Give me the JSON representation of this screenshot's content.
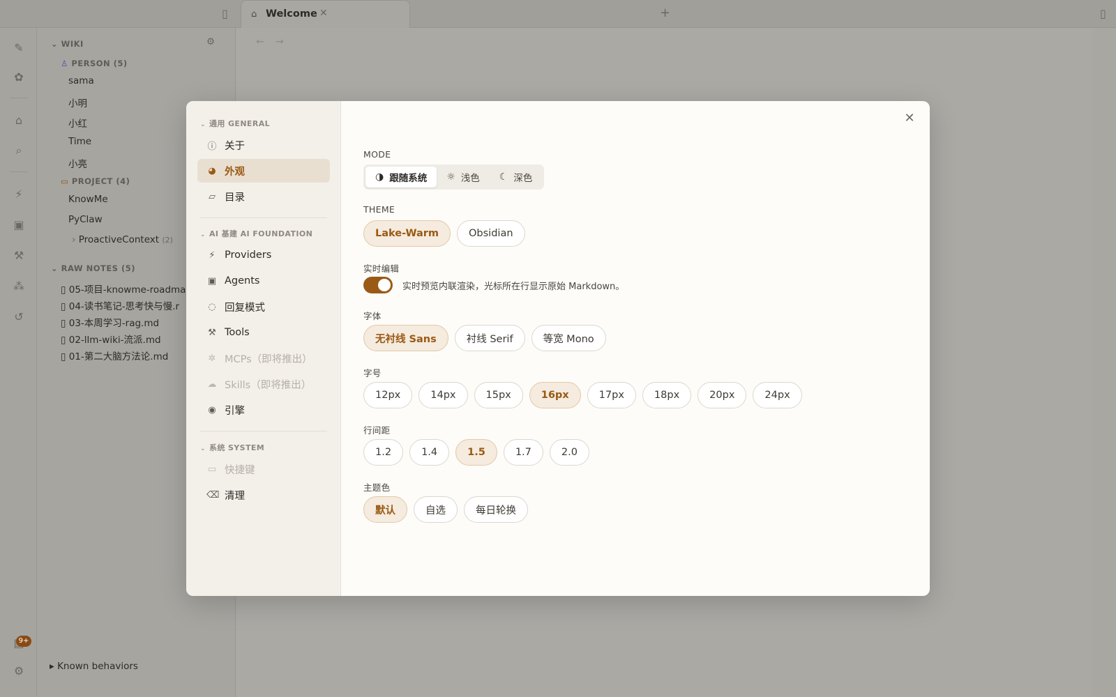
{
  "tabs": {
    "active_label": "Welcome"
  },
  "sidebar_tree": {
    "wiki_header": "WIKI",
    "person_header": "PERSON (5)",
    "persons": [
      "sama",
      "小明",
      "小红",
      "Time",
      "小亮"
    ],
    "project_header": "PROJECT (4)",
    "projects": [
      "KnowMe",
      "PyClaw"
    ],
    "subproject": {
      "label": "ProactiveContext",
      "count": "(2)"
    },
    "raw_notes_header": "RAW NOTES",
    "raw_notes_count": "(5)",
    "raw_notes": [
      "05-项目-knowme-roadma",
      "04-读书笔记-思考快与慢.r",
      "03-本周学习-rag.md",
      "02-llm-wiki-流派.md",
      "01-第二大脑方法论.md"
    ],
    "known_behaviors": "Known behaviors"
  },
  "rail": {
    "badge": "9+"
  },
  "settings": {
    "groups": {
      "general": "通用 GENERAL",
      "ai": "AI 基建 AI FOUNDATION",
      "system": "系统 SYSTEM"
    },
    "items": {
      "about": "关于",
      "appearance": "外观",
      "directory": "目录",
      "providers": "Providers",
      "agents": "Agents",
      "reply_mode": "回复模式",
      "tools": "Tools",
      "mcps": "MCPs（即将推出）",
      "skills": "Skills（即将推出）",
      "engine": "引擎",
      "shortcuts": "快捷键",
      "cleanup": "清理"
    },
    "mode": {
      "label": "MODE",
      "options": [
        "跟随系统",
        "浅色",
        "深色"
      ],
      "selected": "跟随系统"
    },
    "theme": {
      "label": "THEME",
      "options": [
        "Lake-Warm",
        "Obsidian"
      ],
      "selected": "Lake-Warm"
    },
    "live_edit": {
      "label": "实时编辑",
      "enabled": true,
      "description": "实时预览内联渲染，光标所在行显示原始 Markdown。"
    },
    "font": {
      "label": "字体",
      "options": [
        "无衬线 Sans",
        "衬线 Serif",
        "等宽 Mono"
      ],
      "selected": "无衬线 Sans"
    },
    "font_size": {
      "label": "字号",
      "options": [
        "12px",
        "14px",
        "15px",
        "16px",
        "17px",
        "18px",
        "20px",
        "24px"
      ],
      "selected": "16px"
    },
    "line_height": {
      "label": "行间距",
      "options": [
        "1.2",
        "1.4",
        "1.5",
        "1.7",
        "2.0"
      ],
      "selected": "1.5"
    },
    "accent": {
      "label": "主题色",
      "options": [
        "默认",
        "自选",
        "每日轮换"
      ],
      "selected": "默认"
    }
  },
  "colors": {
    "accent": "#9a5a16",
    "accent_bg": "#f5ebde",
    "modal_bg": "#fdfcf9",
    "sidebar_bg": "#f3f0ea"
  }
}
